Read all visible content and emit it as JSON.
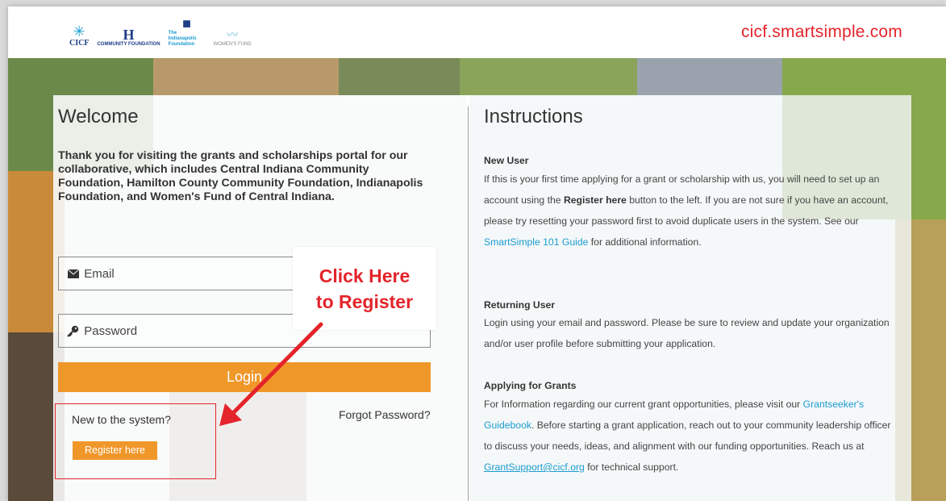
{
  "header": {
    "site_url": "cicf.smartsimple.com",
    "logos": [
      {
        "name": "CICF",
        "sub": ""
      },
      {
        "name": "",
        "sub": "COMMUNITY FOUNDATION"
      },
      {
        "name": "The Indianapolis Foundation",
        "sub": ""
      },
      {
        "name": "WOMEN'S FUND",
        "sub": ""
      }
    ]
  },
  "login": {
    "title": "Welcome",
    "intro": "Thank you for visiting the grants and scholarships portal for our collaborative, which includes Central Indiana Community Foundation, Hamilton County Community Foundation, Indianapolis Foundation, and Women's Fund of Central Indiana.",
    "email_placeholder": "Email",
    "password_placeholder": "Password",
    "login_label": "Login",
    "new_to_system": "New to the system?",
    "forgot_password": "Forgot Password?",
    "register_label": "Register here"
  },
  "callout": {
    "line1": "Click Here",
    "line2": "to Register"
  },
  "instructions": {
    "title": "Instructions",
    "new_user": {
      "heading": "New User",
      "text_1": "If this is your first time applying for a grant or scholarship with us, you will need to set up an account using the ",
      "bold": "Register here",
      "text_2": " button to the left. If you are not sure if you have an account, please try resetting your password first to avoid duplicate users in the system. See our ",
      "link": "SmartSimple 101 Guide",
      "text_3": " for additional information."
    },
    "returning_user": {
      "heading": "Returning User",
      "text": "Login using your email and password. Please be sure to review and update your organization and/or user profile before submitting your application."
    },
    "applying": {
      "heading": "Applying for Grants",
      "text_1": "For Information regarding our current grant opportunities, please visit our ",
      "link": "Grantseeker's Guidebook",
      "text_2": ". Before starting a grant application, reach out to your community leadership officer to discuss your needs, ideas, and alignment with our funding opportunities. Reach us at ",
      "email_link": "GrantSupport@cicf.org",
      "text_3": " for technical support."
    }
  },
  "colors": {
    "accent_orange": "#f0972a",
    "annotation_red": "#e4242b",
    "link_blue": "#1b9bd1"
  }
}
